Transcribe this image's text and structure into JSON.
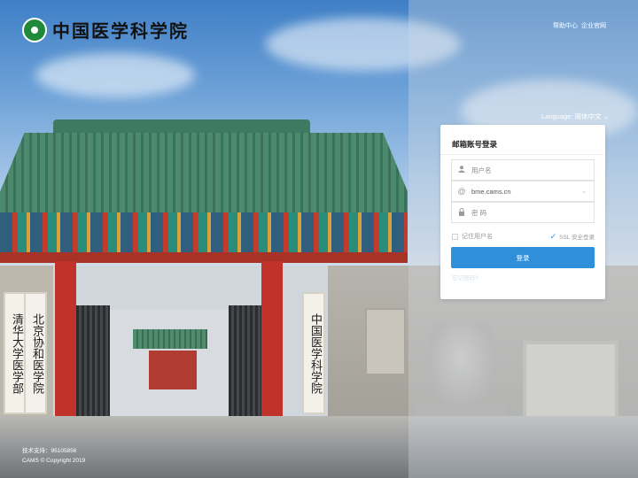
{
  "header": {
    "brand_name": "中国医学科学院",
    "links": [
      "帮助中心",
      "企业官网"
    ]
  },
  "language": {
    "label": "Language:",
    "value": "简体中文",
    "chevron": "chevron-down-icon"
  },
  "login": {
    "title": "邮箱账号登录",
    "username_placeholder": "用户名",
    "domain_value": "bme.cams.cn",
    "password_placeholder": "密 码",
    "remember_label": "记住用户名",
    "ssl_label": "SSL 安全登录",
    "ssl_checked": true,
    "remember_checked": false,
    "submit_label": "登录",
    "forgot_label": "忘记密码?"
  },
  "footer": {
    "support": "技术支持：95105856",
    "copyright": "CAMS © Copyright 2019"
  },
  "scene": {
    "plaque_left_1": "清华大学医学部",
    "plaque_left_2": "北京协和医学院",
    "plaque_right": "中国医学科学院"
  },
  "colors": {
    "accent": "#2f8fd8",
    "emblem": "#1f8a3a"
  }
}
